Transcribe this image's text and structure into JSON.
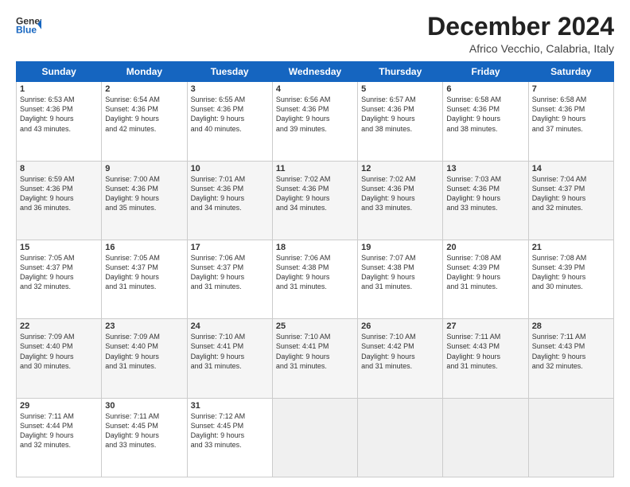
{
  "header": {
    "logo_general": "General",
    "logo_blue": "Blue",
    "title": "December 2024",
    "subtitle": "Africo Vecchio, Calabria, Italy"
  },
  "days_of_week": [
    "Sunday",
    "Monday",
    "Tuesday",
    "Wednesday",
    "Thursday",
    "Friday",
    "Saturday"
  ],
  "weeks": [
    [
      {
        "day": "1",
        "info": "Sunrise: 6:53 AM\nSunset: 4:36 PM\nDaylight: 9 hours\nand 43 minutes."
      },
      {
        "day": "2",
        "info": "Sunrise: 6:54 AM\nSunset: 4:36 PM\nDaylight: 9 hours\nand 42 minutes."
      },
      {
        "day": "3",
        "info": "Sunrise: 6:55 AM\nSunset: 4:36 PM\nDaylight: 9 hours\nand 40 minutes."
      },
      {
        "day": "4",
        "info": "Sunrise: 6:56 AM\nSunset: 4:36 PM\nDaylight: 9 hours\nand 39 minutes."
      },
      {
        "day": "5",
        "info": "Sunrise: 6:57 AM\nSunset: 4:36 PM\nDaylight: 9 hours\nand 38 minutes."
      },
      {
        "day": "6",
        "info": "Sunrise: 6:58 AM\nSunset: 4:36 PM\nDaylight: 9 hours\nand 38 minutes."
      },
      {
        "day": "7",
        "info": "Sunrise: 6:58 AM\nSunset: 4:36 PM\nDaylight: 9 hours\nand 37 minutes."
      }
    ],
    [
      {
        "day": "8",
        "info": "Sunrise: 6:59 AM\nSunset: 4:36 PM\nDaylight: 9 hours\nand 36 minutes."
      },
      {
        "day": "9",
        "info": "Sunrise: 7:00 AM\nSunset: 4:36 PM\nDaylight: 9 hours\nand 35 minutes."
      },
      {
        "day": "10",
        "info": "Sunrise: 7:01 AM\nSunset: 4:36 PM\nDaylight: 9 hours\nand 34 minutes."
      },
      {
        "day": "11",
        "info": "Sunrise: 7:02 AM\nSunset: 4:36 PM\nDaylight: 9 hours\nand 34 minutes."
      },
      {
        "day": "12",
        "info": "Sunrise: 7:02 AM\nSunset: 4:36 PM\nDaylight: 9 hours\nand 33 minutes."
      },
      {
        "day": "13",
        "info": "Sunrise: 7:03 AM\nSunset: 4:36 PM\nDaylight: 9 hours\nand 33 minutes."
      },
      {
        "day": "14",
        "info": "Sunrise: 7:04 AM\nSunset: 4:37 PM\nDaylight: 9 hours\nand 32 minutes."
      }
    ],
    [
      {
        "day": "15",
        "info": "Sunrise: 7:05 AM\nSunset: 4:37 PM\nDaylight: 9 hours\nand 32 minutes."
      },
      {
        "day": "16",
        "info": "Sunrise: 7:05 AM\nSunset: 4:37 PM\nDaylight: 9 hours\nand 31 minutes."
      },
      {
        "day": "17",
        "info": "Sunrise: 7:06 AM\nSunset: 4:37 PM\nDaylight: 9 hours\nand 31 minutes."
      },
      {
        "day": "18",
        "info": "Sunrise: 7:06 AM\nSunset: 4:38 PM\nDaylight: 9 hours\nand 31 minutes."
      },
      {
        "day": "19",
        "info": "Sunrise: 7:07 AM\nSunset: 4:38 PM\nDaylight: 9 hours\nand 31 minutes."
      },
      {
        "day": "20",
        "info": "Sunrise: 7:08 AM\nSunset: 4:39 PM\nDaylight: 9 hours\nand 31 minutes."
      },
      {
        "day": "21",
        "info": "Sunrise: 7:08 AM\nSunset: 4:39 PM\nDaylight: 9 hours\nand 30 minutes."
      }
    ],
    [
      {
        "day": "22",
        "info": "Sunrise: 7:09 AM\nSunset: 4:40 PM\nDaylight: 9 hours\nand 30 minutes."
      },
      {
        "day": "23",
        "info": "Sunrise: 7:09 AM\nSunset: 4:40 PM\nDaylight: 9 hours\nand 31 minutes."
      },
      {
        "day": "24",
        "info": "Sunrise: 7:10 AM\nSunset: 4:41 PM\nDaylight: 9 hours\nand 31 minutes."
      },
      {
        "day": "25",
        "info": "Sunrise: 7:10 AM\nSunset: 4:41 PM\nDaylight: 9 hours\nand 31 minutes."
      },
      {
        "day": "26",
        "info": "Sunrise: 7:10 AM\nSunset: 4:42 PM\nDaylight: 9 hours\nand 31 minutes."
      },
      {
        "day": "27",
        "info": "Sunrise: 7:11 AM\nSunset: 4:43 PM\nDaylight: 9 hours\nand 31 minutes."
      },
      {
        "day": "28",
        "info": "Sunrise: 7:11 AM\nSunset: 4:43 PM\nDaylight: 9 hours\nand 32 minutes."
      }
    ],
    [
      {
        "day": "29",
        "info": "Sunrise: 7:11 AM\nSunset: 4:44 PM\nDaylight: 9 hours\nand 32 minutes."
      },
      {
        "day": "30",
        "info": "Sunrise: 7:11 AM\nSunset: 4:45 PM\nDaylight: 9 hours\nand 33 minutes."
      },
      {
        "day": "31",
        "info": "Sunrise: 7:12 AM\nSunset: 4:45 PM\nDaylight: 9 hours\nand 33 minutes."
      },
      {
        "day": "",
        "info": ""
      },
      {
        "day": "",
        "info": ""
      },
      {
        "day": "",
        "info": ""
      },
      {
        "day": "",
        "info": ""
      }
    ]
  ]
}
